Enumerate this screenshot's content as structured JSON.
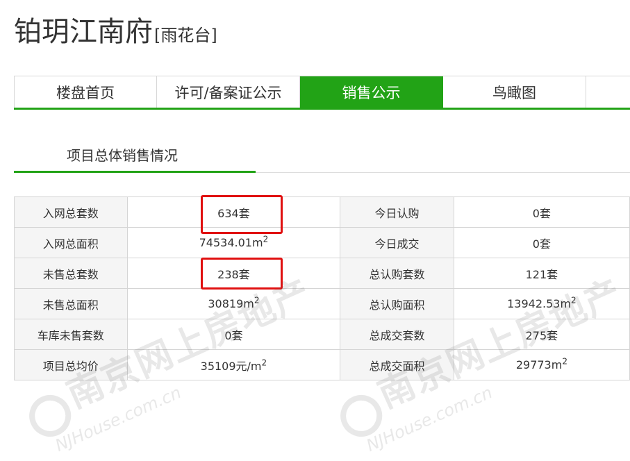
{
  "page": {
    "title": "铂玥江南府",
    "district": "[雨花台]"
  },
  "tabs": [
    {
      "label": "楼盘首页",
      "active": false
    },
    {
      "label": "许可/备案证公示",
      "active": false
    },
    {
      "label": "销售公示",
      "active": true
    },
    {
      "label": "鸟瞰图",
      "active": false
    }
  ],
  "section": {
    "title": "项目总体销售情况"
  },
  "stats": {
    "rows": [
      {
        "label1": "入网总套数",
        "value1": "634套",
        "label2": "今日认购",
        "value2": "0套"
      },
      {
        "label1": "入网总面积",
        "value1": "74534.01m",
        "value1_sup": "2",
        "label2": "今日成交",
        "value2": "0套"
      },
      {
        "label1": "未售总套数",
        "value1": "238套",
        "label2": "总认购套数",
        "value2": "121套"
      },
      {
        "label1": "未售总面积",
        "value1": "30819m",
        "value1_sup": "2",
        "label2": "总认购面积",
        "value2": "13942.53m",
        "value2_sup": "2"
      },
      {
        "label1": "车库未售套数",
        "value1": "0套",
        "label2": "总成交套数",
        "value2": "275套"
      },
      {
        "label1": "项目总均价",
        "value1": "35109元/m",
        "value1_sup": "2",
        "label2": "总成交面积",
        "value2": "29773m",
        "value2_sup": "2"
      }
    ]
  },
  "watermark": {
    "name": "南京网上房地产",
    "url": "NJHouse.com.cn"
  },
  "colors": {
    "accent_green": "#22a316",
    "highlight_red": "#e01010",
    "label_bg": "#f5f5f5"
  }
}
